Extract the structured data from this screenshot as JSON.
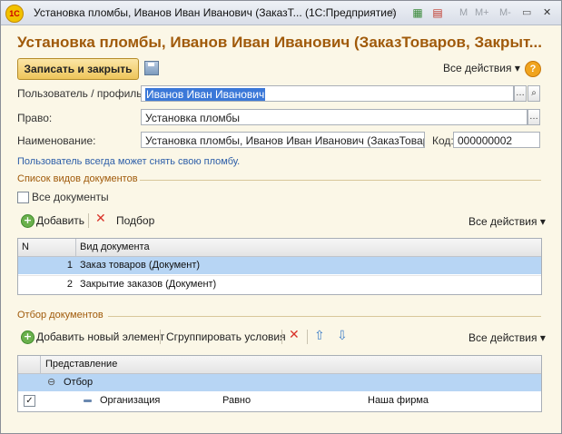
{
  "window": {
    "title": "Установка пломбы, Иванов Иван Иванович (ЗаказТ... (1С:Предприятие)",
    "logo_text": "1C",
    "title_buttons": [
      "M",
      "M+",
      "M-",
      "▭",
      "✕"
    ]
  },
  "header": {
    "title": "Установка пломбы, Иванов Иван Иванович (ЗаказТоваров, Закрыт..."
  },
  "toolbar": {
    "save_close_label": "Записать и закрыть",
    "all_actions_label": "Все действия",
    "help_label": "?"
  },
  "form": {
    "user_label": "Пользователь / профиль:",
    "user_value": "Иванов Иван Иванович",
    "right_label": "Право:",
    "right_value": "Установка пломбы",
    "name_label": "Наименование:",
    "name_value": "Установка пломбы, Иванов Иван Иванович (ЗаказТоваров,",
    "code_label": "Код:",
    "code_value": "000000002",
    "note": "Пользователь всегда может снять свою пломбу."
  },
  "doc_types": {
    "section_title": "Список видов документов",
    "all_docs_label": "Все документы",
    "all_docs_checked": false,
    "add_label": "Добавить",
    "pick_label": "Подбор",
    "all_actions_label": "Все действия",
    "columns": [
      "N",
      "Вид документа"
    ],
    "rows": [
      {
        "n": "1",
        "name": "Заказ товаров (Документ)",
        "selected": true
      },
      {
        "n": "2",
        "name": "Закрытие заказов (Документ)",
        "selected": false
      }
    ]
  },
  "filter": {
    "section_title": "Отбор документов",
    "add_new_label": "Добавить новый элемент",
    "group_label": "Сгруппировать условия",
    "all_actions_label": "Все действия",
    "column": "Представление",
    "group_row": "Отбор",
    "condition": {
      "checked": true,
      "field": "Организация",
      "op": "Равно",
      "value": "Наша фирма"
    }
  }
}
